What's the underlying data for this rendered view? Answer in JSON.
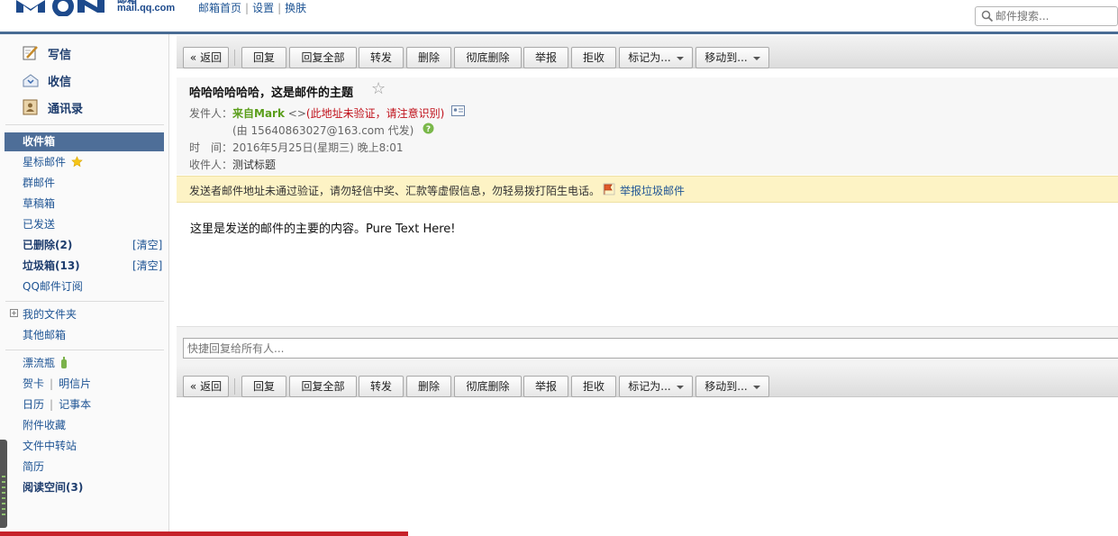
{
  "header": {
    "logo_domain": "mail.qq.com",
    "logo_cn": "邮箱",
    "nav": [
      "邮箱首页",
      "设置",
      "换肤"
    ],
    "nav_sep": "|",
    "search_placeholder": "邮件搜索..."
  },
  "sidebar": {
    "compose": "写信",
    "receive": "收信",
    "contacts": "通讯录",
    "inbox": "收件箱",
    "starred": "星标邮件",
    "group": "群邮件",
    "drafts": "草稿箱",
    "sent": "已发送",
    "deleted": "已删除(2)",
    "deleted_clear": "[清空]",
    "spam": "垃圾箱(13)",
    "spam_clear": "[清空]",
    "subscribe": "QQ邮件订阅",
    "my_folders": "我的文件夹",
    "other_mailboxes": "其他邮箱",
    "drift_bottle": "漂流瓶",
    "greeting_card": "贺卡",
    "postcard": "明信片",
    "calendar": "日历",
    "notebook": "记事本",
    "attachments": "附件收藏",
    "file_transfer": "文件中转站",
    "resume": "简历",
    "reading_space": "阅读空间(3)",
    "pipe": "|",
    "folder_toggle": "+"
  },
  "toolbar": {
    "back": "« 返回",
    "reply": "回复",
    "reply_all": "回复全部",
    "forward": "转发",
    "delete": "删除",
    "delete_perm": "彻底删除",
    "report": "举报",
    "reject": "拒收",
    "mark_as": "标记为...",
    "move_to": "移动到..."
  },
  "mail": {
    "subject": "哈哈哈哈哈哈，这是邮件的主题",
    "star": "☆",
    "from_label": "发件人：",
    "from_name": "来自Mark",
    "from_addr": " <>",
    "from_warning": "(此地址未验证，请注意识别)",
    "via": "(由 15640863027@163.com 代发)",
    "time_label": "时　间：",
    "time_value": "2016年5月25日(星期三) 晚上8:01",
    "to_label": "收件人：",
    "to_value": "测试标题",
    "warning": "发送者邮件地址未通过验证，请勿轻信中奖、汇款等虚假信息，勿轻易拨打陌生电话。",
    "report_spam": "举报垃圾邮件",
    "body": "这里是发送的邮件的主要的内容。Pure Text Here!"
  },
  "reply": {
    "placeholder": "快捷回复给所有人..."
  },
  "colors": {
    "header_bar": "#496c94",
    "inbox_active": "#4e6e98",
    "warning_bg": "#fdf3c5",
    "sender_green": "#5a9e1a",
    "warning_red": "#c0101a",
    "link_blue": "#1e5494",
    "bottom_red": "#c6222a"
  }
}
